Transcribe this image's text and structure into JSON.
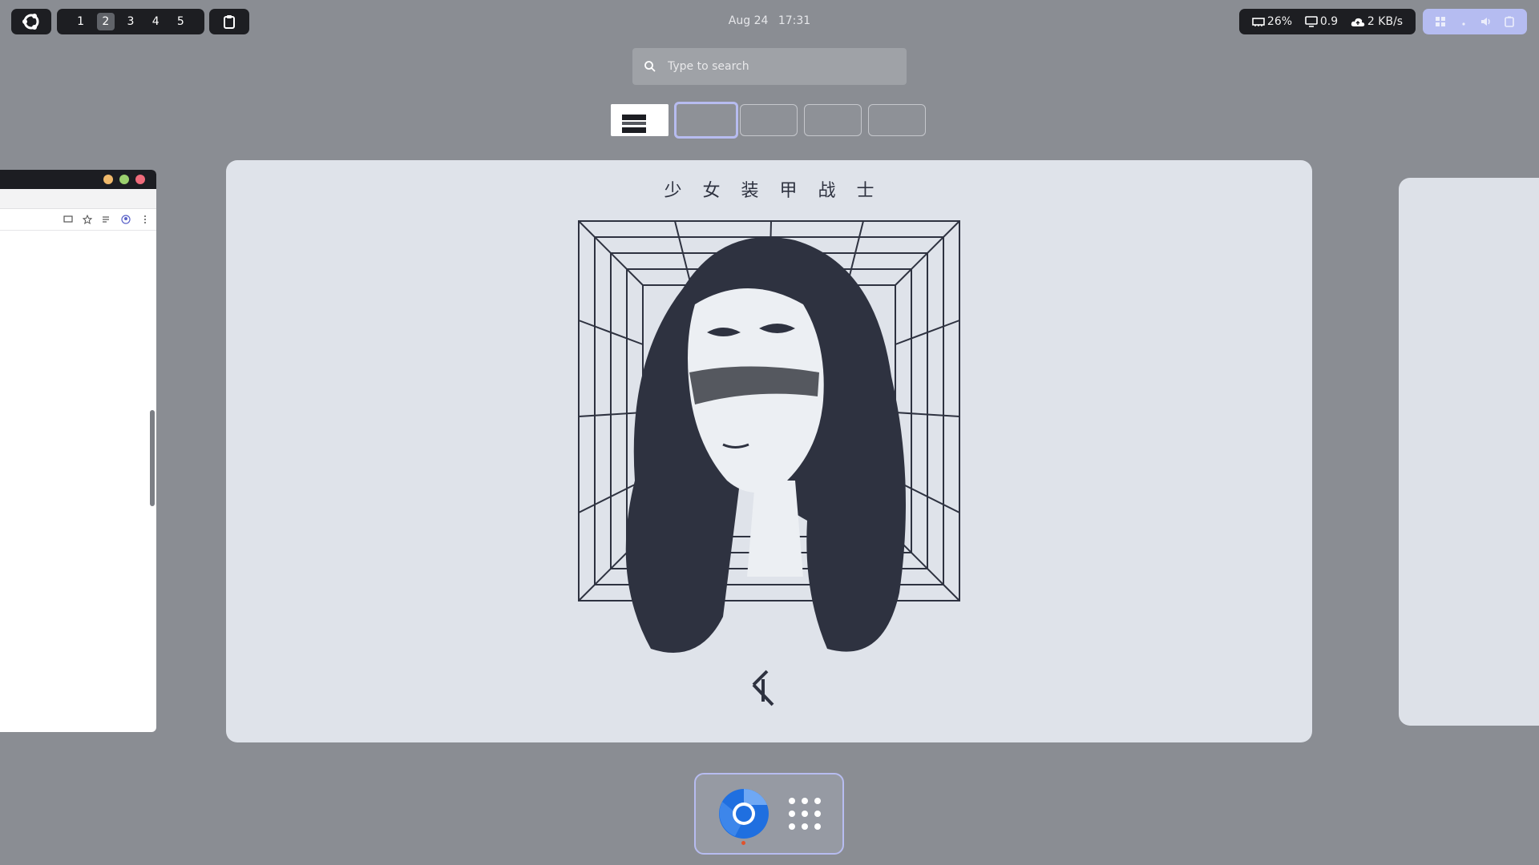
{
  "topbar": {
    "workspaces": [
      "1",
      "2",
      "3",
      "4",
      "5"
    ],
    "active_workspace": "2",
    "date": "Aug 24",
    "time": "17:31",
    "stats": {
      "memory": "26%",
      "load": "0.9",
      "network": "2 KB/s"
    }
  },
  "search": {
    "placeholder": "Type to search"
  },
  "main_window": {
    "artwork_title": "少女装甲战士"
  },
  "dock": {
    "apps": [
      "Chromium",
      "Show Applications"
    ]
  },
  "colors": {
    "background": "#8a8d93",
    "panel": "#1d1e22",
    "accent": "#b7bcf0",
    "art_bg": "#dfe3ea",
    "ink": "#2e3240"
  }
}
